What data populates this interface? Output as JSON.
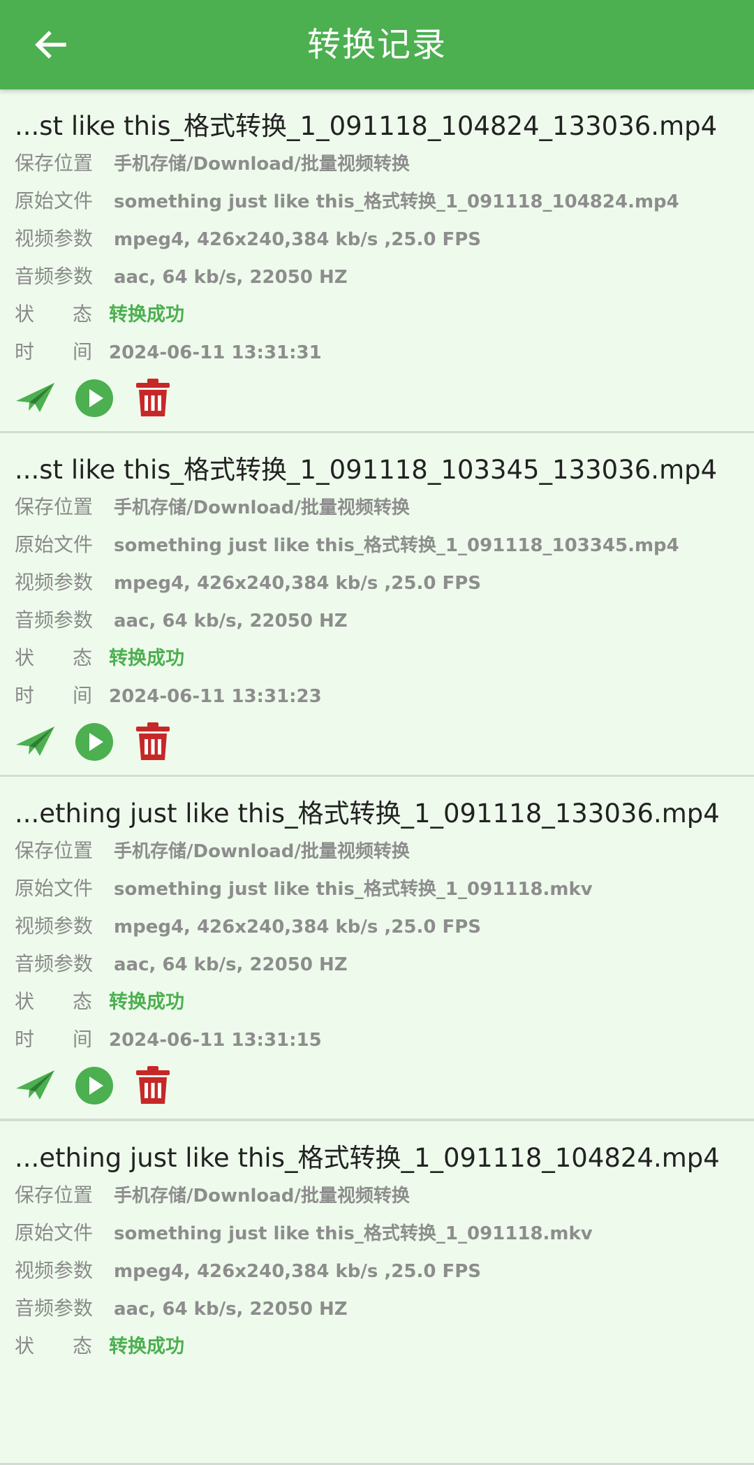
{
  "header": {
    "title": "转换记录",
    "back_icon": "arrow-left-icon"
  },
  "labels": {
    "save_location": "保存位置",
    "original_file": "原始文件",
    "video_params": "视频参数",
    "audio_params": "音频参数",
    "status_a": "状",
    "status_b": "态",
    "time_a": "时",
    "time_b": "间"
  },
  "colors": {
    "accent": "#4caf50",
    "background": "#eefbec",
    "delete": "#c62828",
    "success": "#4caf50"
  },
  "actions": {
    "send_icon": "paper-plane-icon",
    "play_icon": "play-circle-icon",
    "delete_icon": "trash-icon"
  },
  "records": [
    {
      "filename": "...st like this_格式转换_1_091118_104824_133036.mp4",
      "save_location": "手机存储/Download/批量视频转换",
      "original_file": "something just like this_格式转换_1_091118_104824.mp4",
      "video_params": "mpeg4, 426x240,384 kb/s ,25.0 FPS",
      "audio_params": "aac, 64 kb/s, 22050 HZ",
      "status": "转换成功",
      "time": "2024-06-11 13:31:31"
    },
    {
      "filename": "...st like this_格式转换_1_091118_103345_133036.mp4",
      "save_location": "手机存储/Download/批量视频转换",
      "original_file": "something just like this_格式转换_1_091118_103345.mp4",
      "video_params": "mpeg4, 426x240,384 kb/s ,25.0 FPS",
      "audio_params": "aac, 64 kb/s, 22050 HZ",
      "status": "转换成功",
      "time": "2024-06-11 13:31:23"
    },
    {
      "filename": "...ething just like this_格式转换_1_091118_133036.mp4",
      "save_location": "手机存储/Download/批量视频转换",
      "original_file": "something just like this_格式转换_1_091118.mkv",
      "video_params": "mpeg4, 426x240,384 kb/s ,25.0 FPS",
      "audio_params": "aac, 64 kb/s, 22050 HZ",
      "status": "转换成功",
      "time": "2024-06-11 13:31:15"
    },
    {
      "filename": "...ething just like this_格式转换_1_091118_104824.mp4",
      "save_location": "手机存储/Download/批量视频转换",
      "original_file": "something just like this_格式转换_1_091118.mkv",
      "video_params": "mpeg4, 426x240,384 kb/s ,25.0 FPS",
      "audio_params": "aac, 64 kb/s, 22050 HZ",
      "status": "转换成功",
      "time": ""
    }
  ]
}
